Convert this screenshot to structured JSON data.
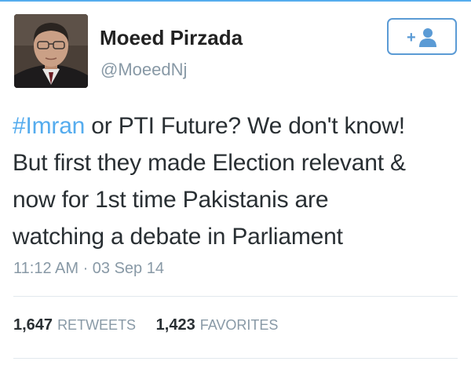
{
  "tweet": {
    "author": {
      "name": "Moeed Pirzada",
      "handle": "@MoeedNj",
      "avatar": "profile-photo"
    },
    "follow_button": {
      "icon": "add-user-icon",
      "label": "+"
    },
    "text": {
      "hashtag": "#Imran",
      "line1_rest": " or PTI Future? We don't know!",
      "line2": "But first they made Election relevant &",
      "line3": "now for 1st time Pakistanis are",
      "line4": "watching a debate in Parliament"
    },
    "timestamp": "11:12 AM · 03 Sep 14",
    "stats": {
      "retweets_count": "1,647",
      "retweets_label": "RETWEETS",
      "favorites_count": "1,423",
      "favorites_label": "FAVORITES"
    }
  },
  "colors": {
    "accent": "#55acee",
    "follow_border": "#5b9bd5",
    "text": "#292f33",
    "muted": "#8899a6",
    "divider": "#e1e8ed"
  }
}
